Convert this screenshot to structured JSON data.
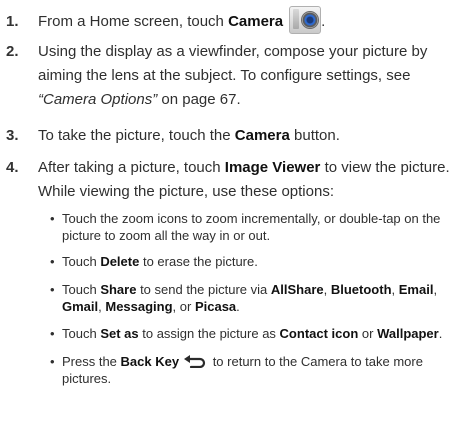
{
  "steps": [
    {
      "number": "1.",
      "t1": "From a Home screen, touch ",
      "b1": "Camera",
      "t2": "."
    },
    {
      "number": "2.",
      "text": "Using the display as a viewfinder, compose your picture by aiming the lens at the subject. To configure settings, see ",
      "link": "“Camera Options”",
      "after": " on page 67."
    },
    {
      "number": "3.",
      "t1": "To take the picture, touch the ",
      "b1": "Camera",
      "t2": " button."
    },
    {
      "number": "4.",
      "t1": "After taking a picture, touch ",
      "b1": "Image Viewer",
      "t2": " to view the picture. While viewing the picture, use these options:"
    }
  ],
  "bullets": [
    {
      "dot": "•",
      "t1": "Touch the zoom icons to zoom incrementally, or double-tap on the picture to zoom all the way in or out."
    },
    {
      "dot": "•",
      "t1": "Touch ",
      "b1": "Delete",
      "t2": " to erase the picture."
    },
    {
      "dot": "•",
      "t1": "Touch ",
      "b1": "Share",
      "t2": " to send the picture via ",
      "b2": "AllShare",
      "t3": ", ",
      "b3": "Bluetooth",
      "t4": ", ",
      "b4": "Email",
      "t5": ", ",
      "b5": "Gmail",
      "t6": ", ",
      "b6": "Messaging",
      "t7": ", or ",
      "b7": "Picasa",
      "t8": "."
    },
    {
      "dot": "•",
      "t1": "Touch ",
      "b1": "Set as",
      "t2": " to assign the picture as ",
      "b2": "Contact icon",
      "t3": " or ",
      "b3": "Wallpaper",
      "t4": "."
    },
    {
      "dot": "•",
      "t1": "Press the ",
      "b1": "Back Key",
      "t2": " to return to the Camera to take more pictures."
    }
  ],
  "icons": {
    "camera": "camera-app-icon",
    "back": "back-key-icon"
  },
  "colors": {
    "text": "#2f2f2f",
    "bold": "#111111"
  }
}
